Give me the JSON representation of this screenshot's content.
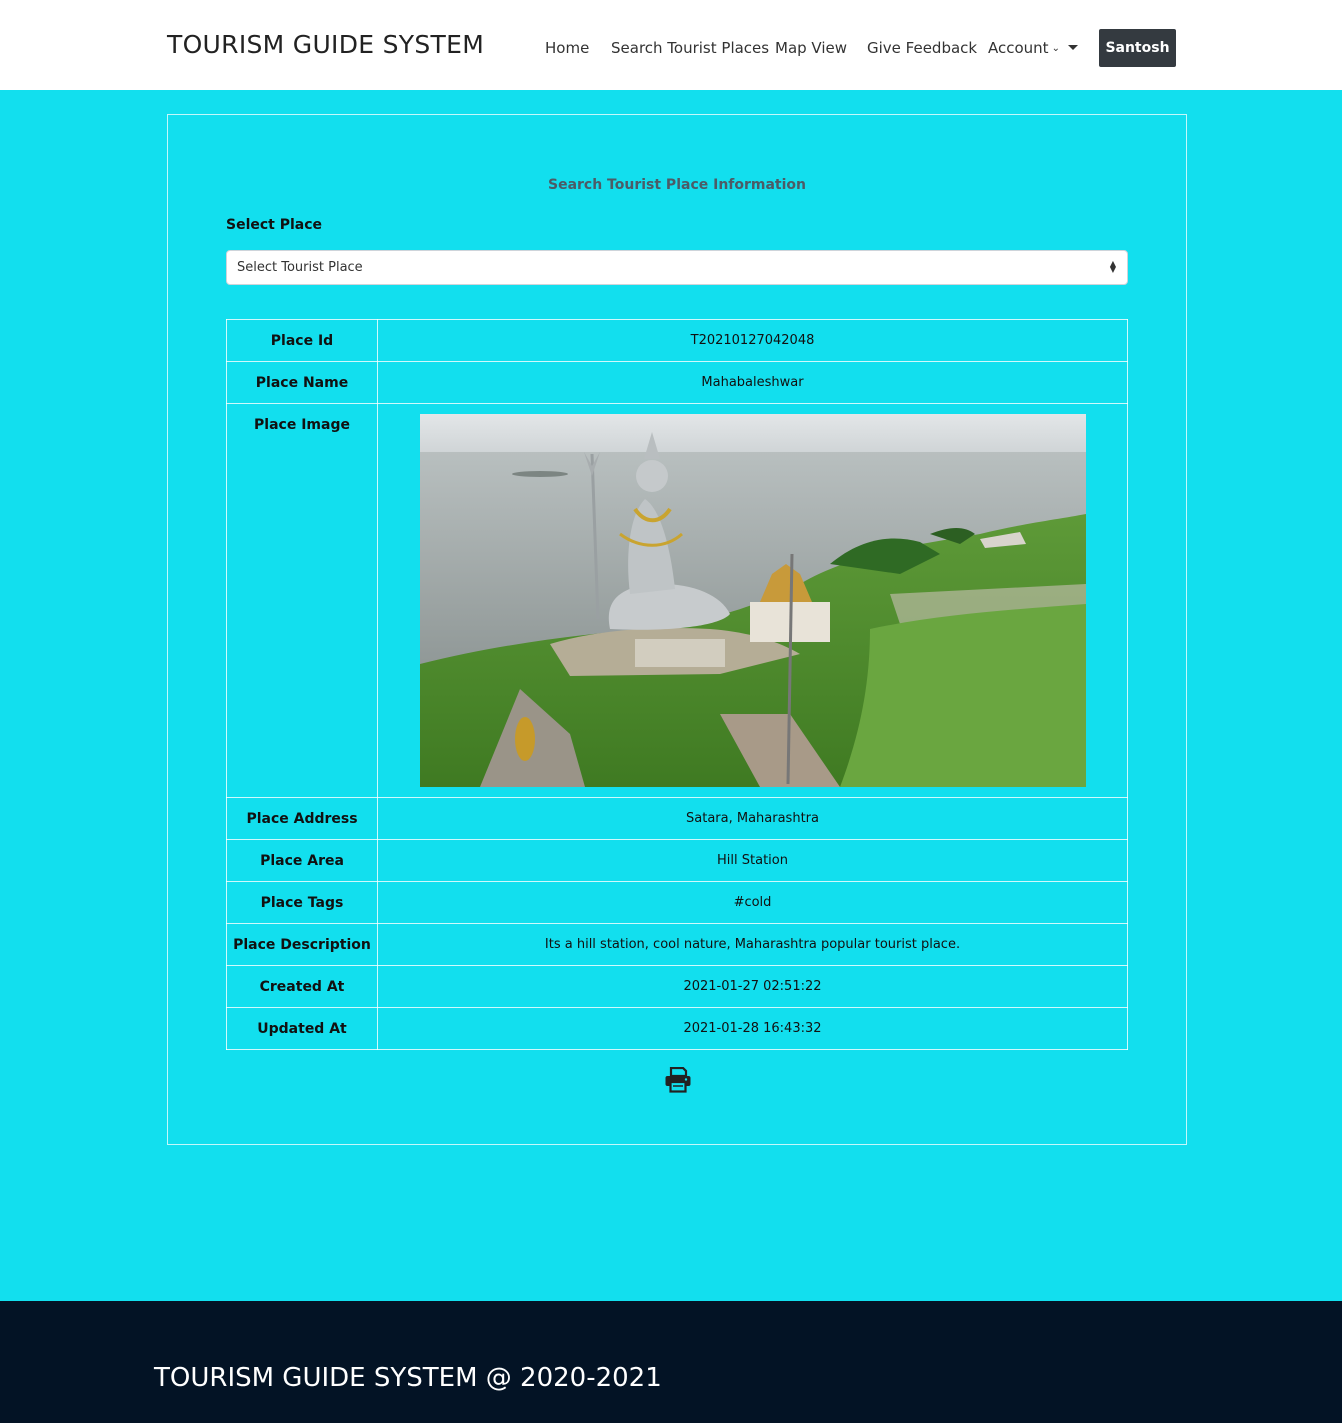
{
  "nav": {
    "brand": "TOURISM GUIDE SYSTEM",
    "links": [
      "Home",
      "Search Tourist Places",
      "Map View",
      "Give Feedback"
    ],
    "account_label": "Account",
    "user_label": "Santosh"
  },
  "main": {
    "title": "Search Tourist Place Information",
    "select_label": "Select Place",
    "select_value": "Select Tourist Place",
    "rows": {
      "id": {
        "key": "Place Id",
        "value": "T20210127042048"
      },
      "name": {
        "key": "Place Name",
        "value": "Mahabaleshwar"
      },
      "image": {
        "key": "Place Image"
      },
      "address": {
        "key": "Place Address",
        "value": "Satara, Maharashtra"
      },
      "area": {
        "key": "Place Area",
        "value": "Hill Station"
      },
      "tags": {
        "key": "Place Tags",
        "value": "#cold"
      },
      "description": {
        "key": "Place Description",
        "value": "Its a hill station, cool nature, Maharashtra popular tourist place."
      },
      "created": {
        "key": "Created At",
        "value": "2021-01-27 02:51:22"
      },
      "updated": {
        "key": "Updated At",
        "value": "2021-01-28 16:43:32"
      }
    },
    "print_icon": "print-icon"
  },
  "footer": {
    "text": "TOURISM GUIDE SYSTEM @ 2020-2021"
  },
  "colors": {
    "page_bg": "#12dfee",
    "footer_bg": "#031325",
    "user_button_bg": "#343a40"
  }
}
